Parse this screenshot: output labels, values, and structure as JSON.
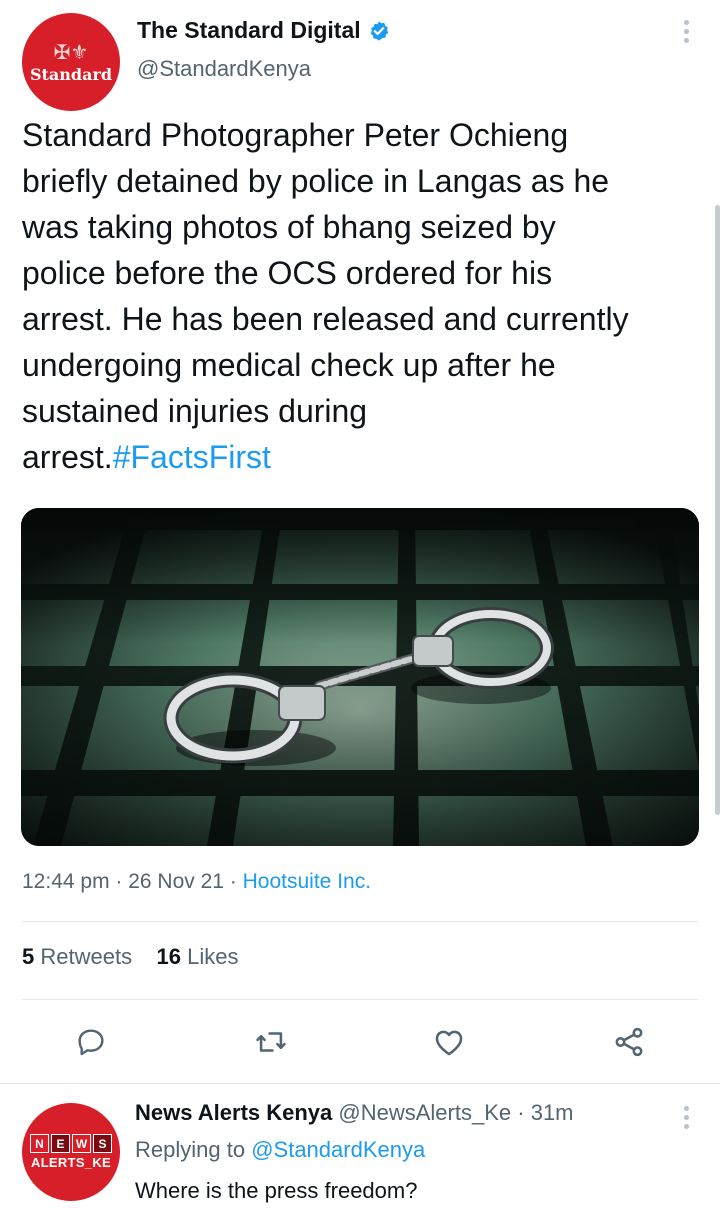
{
  "tweet": {
    "author_name": "The Standard Digital",
    "author_handle": "@StandardKenya",
    "avatar_text": "Standard",
    "text_main": "Standard Photographer Peter Ochieng\nbriefly detained by police in Langas as he\nwas taking photos of bhang seized by\npolice before the  OCS ordered for his\narrest. He has been released and currently\nundergoing medical check up after he\nsustained injuries during\narrest.",
    "hashtag": "#FactsFirst",
    "time": "12:44 pm",
    "date": "26 Nov 21",
    "source": "Hootsuite Inc.",
    "retweets_count": "5",
    "retweets_label": "Retweets",
    "likes_count": "16",
    "likes_label": "Likes"
  },
  "reply": {
    "author_name": "News Alerts Kenya",
    "author_handle": "@NewsAlerts_Ke",
    "age": "31m",
    "replying_prefix": "Replying to",
    "replying_to": "@StandardKenya",
    "text": "Where is the press freedom?",
    "avatar_letters": [
      "N",
      "E",
      "W",
      "S"
    ],
    "avatar_sub": "ALERTS_KE"
  },
  "colors": {
    "accent": "#1d9bf0",
    "secondary_text": "#536471",
    "brand_red": "#d71f2a"
  },
  "icons": [
    "verified-badge-icon",
    "more-options-icon",
    "reply-icon",
    "retweet-icon",
    "like-icon",
    "share-icon"
  ]
}
